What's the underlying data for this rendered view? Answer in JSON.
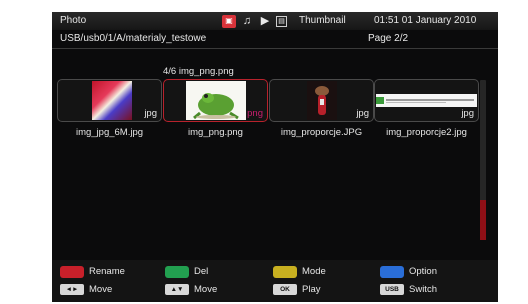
{
  "header": {
    "title": "Photo",
    "icons": [
      "photo-icon",
      "music-icon",
      "video-icon",
      "film-icon"
    ],
    "view_mode": "Thumbnail",
    "clock": "01:51 01 January 2010"
  },
  "pathbar": {
    "path": "USB/usb0/1/A/materialy_testowe",
    "page": "Page 2/2"
  },
  "caption": "4/6 img_png.png",
  "thumbnails": [
    {
      "ext": "jpg",
      "filename": "img_jpg_6M.jpg",
      "selected": false
    },
    {
      "ext": "png",
      "filename": "img_png.png",
      "selected": true
    },
    {
      "ext": "jpg",
      "filename": "img_proporcje.JPG",
      "selected": false
    },
    {
      "ext": "jpg",
      "filename": "img_proporcje2.jpg",
      "selected": false
    }
  ],
  "footer": {
    "rename": "Rename",
    "del": "Del",
    "mode": "Mode",
    "option": "Option",
    "move1": "Move",
    "move2": "Move",
    "play": "Play",
    "switch": "Switch",
    "key_lr": "◄►",
    "key_ud": "▲▼",
    "key_ok": "OK",
    "key_usb": "USB"
  },
  "colors": {
    "red": "#c8202a",
    "green": "#22a050",
    "yellow": "#c8b020",
    "blue": "#2a6ed8",
    "selection": "#b8222c"
  }
}
